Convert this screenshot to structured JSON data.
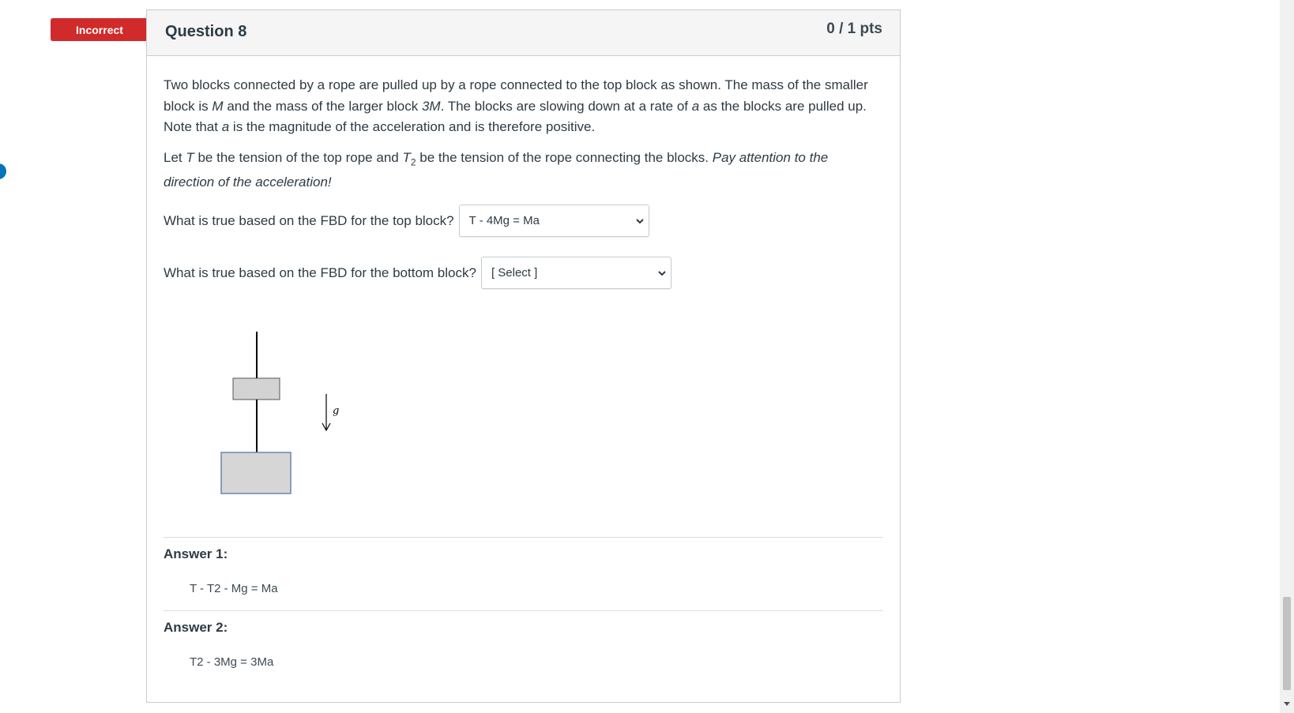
{
  "badge": {
    "label": "Incorrect",
    "color": "#d12a2a"
  },
  "question": {
    "title": "Question 8",
    "points": "0 / 1 pts",
    "para1": {
      "t1": "Two blocks connected by a rope are pulled up by a rope connected to the top block as shown.   The mass of the smaller block is ",
      "m": "M",
      "t2": " and the mass of the larger block ",
      "m3": "3M",
      "t3": ".  The blocks are slowing down at a rate of ",
      "a1": "a",
      "t4": " as the blocks are pulled up. Note that ",
      "a2": "a",
      "t5": " is the magnitude of the acceleration and is therefore positive."
    },
    "para2": {
      "t1": "Let ",
      "T": "T",
      "t2": " be the tension of the top rope and ",
      "T2": "T",
      "T2sub": "2",
      "t3": " be the tension of the rope connecting the blocks.  ",
      "italic": "Pay attention to the direction of the acceleration!"
    },
    "q1": {
      "label": "What is true based on the FBD for the top block?",
      "selected": "T - 4Mg = Ma"
    },
    "q2": {
      "label": "What is true based on the FBD for the bottom block?",
      "selected": "[ Select ]"
    },
    "diagram": {
      "g_label": "g"
    }
  },
  "answers": [
    {
      "label": "Answer 1:",
      "value": "T - T2 - Mg = Ma"
    },
    {
      "label": "Answer 2:",
      "value": "T2 - 3Mg = 3Ma"
    }
  ]
}
